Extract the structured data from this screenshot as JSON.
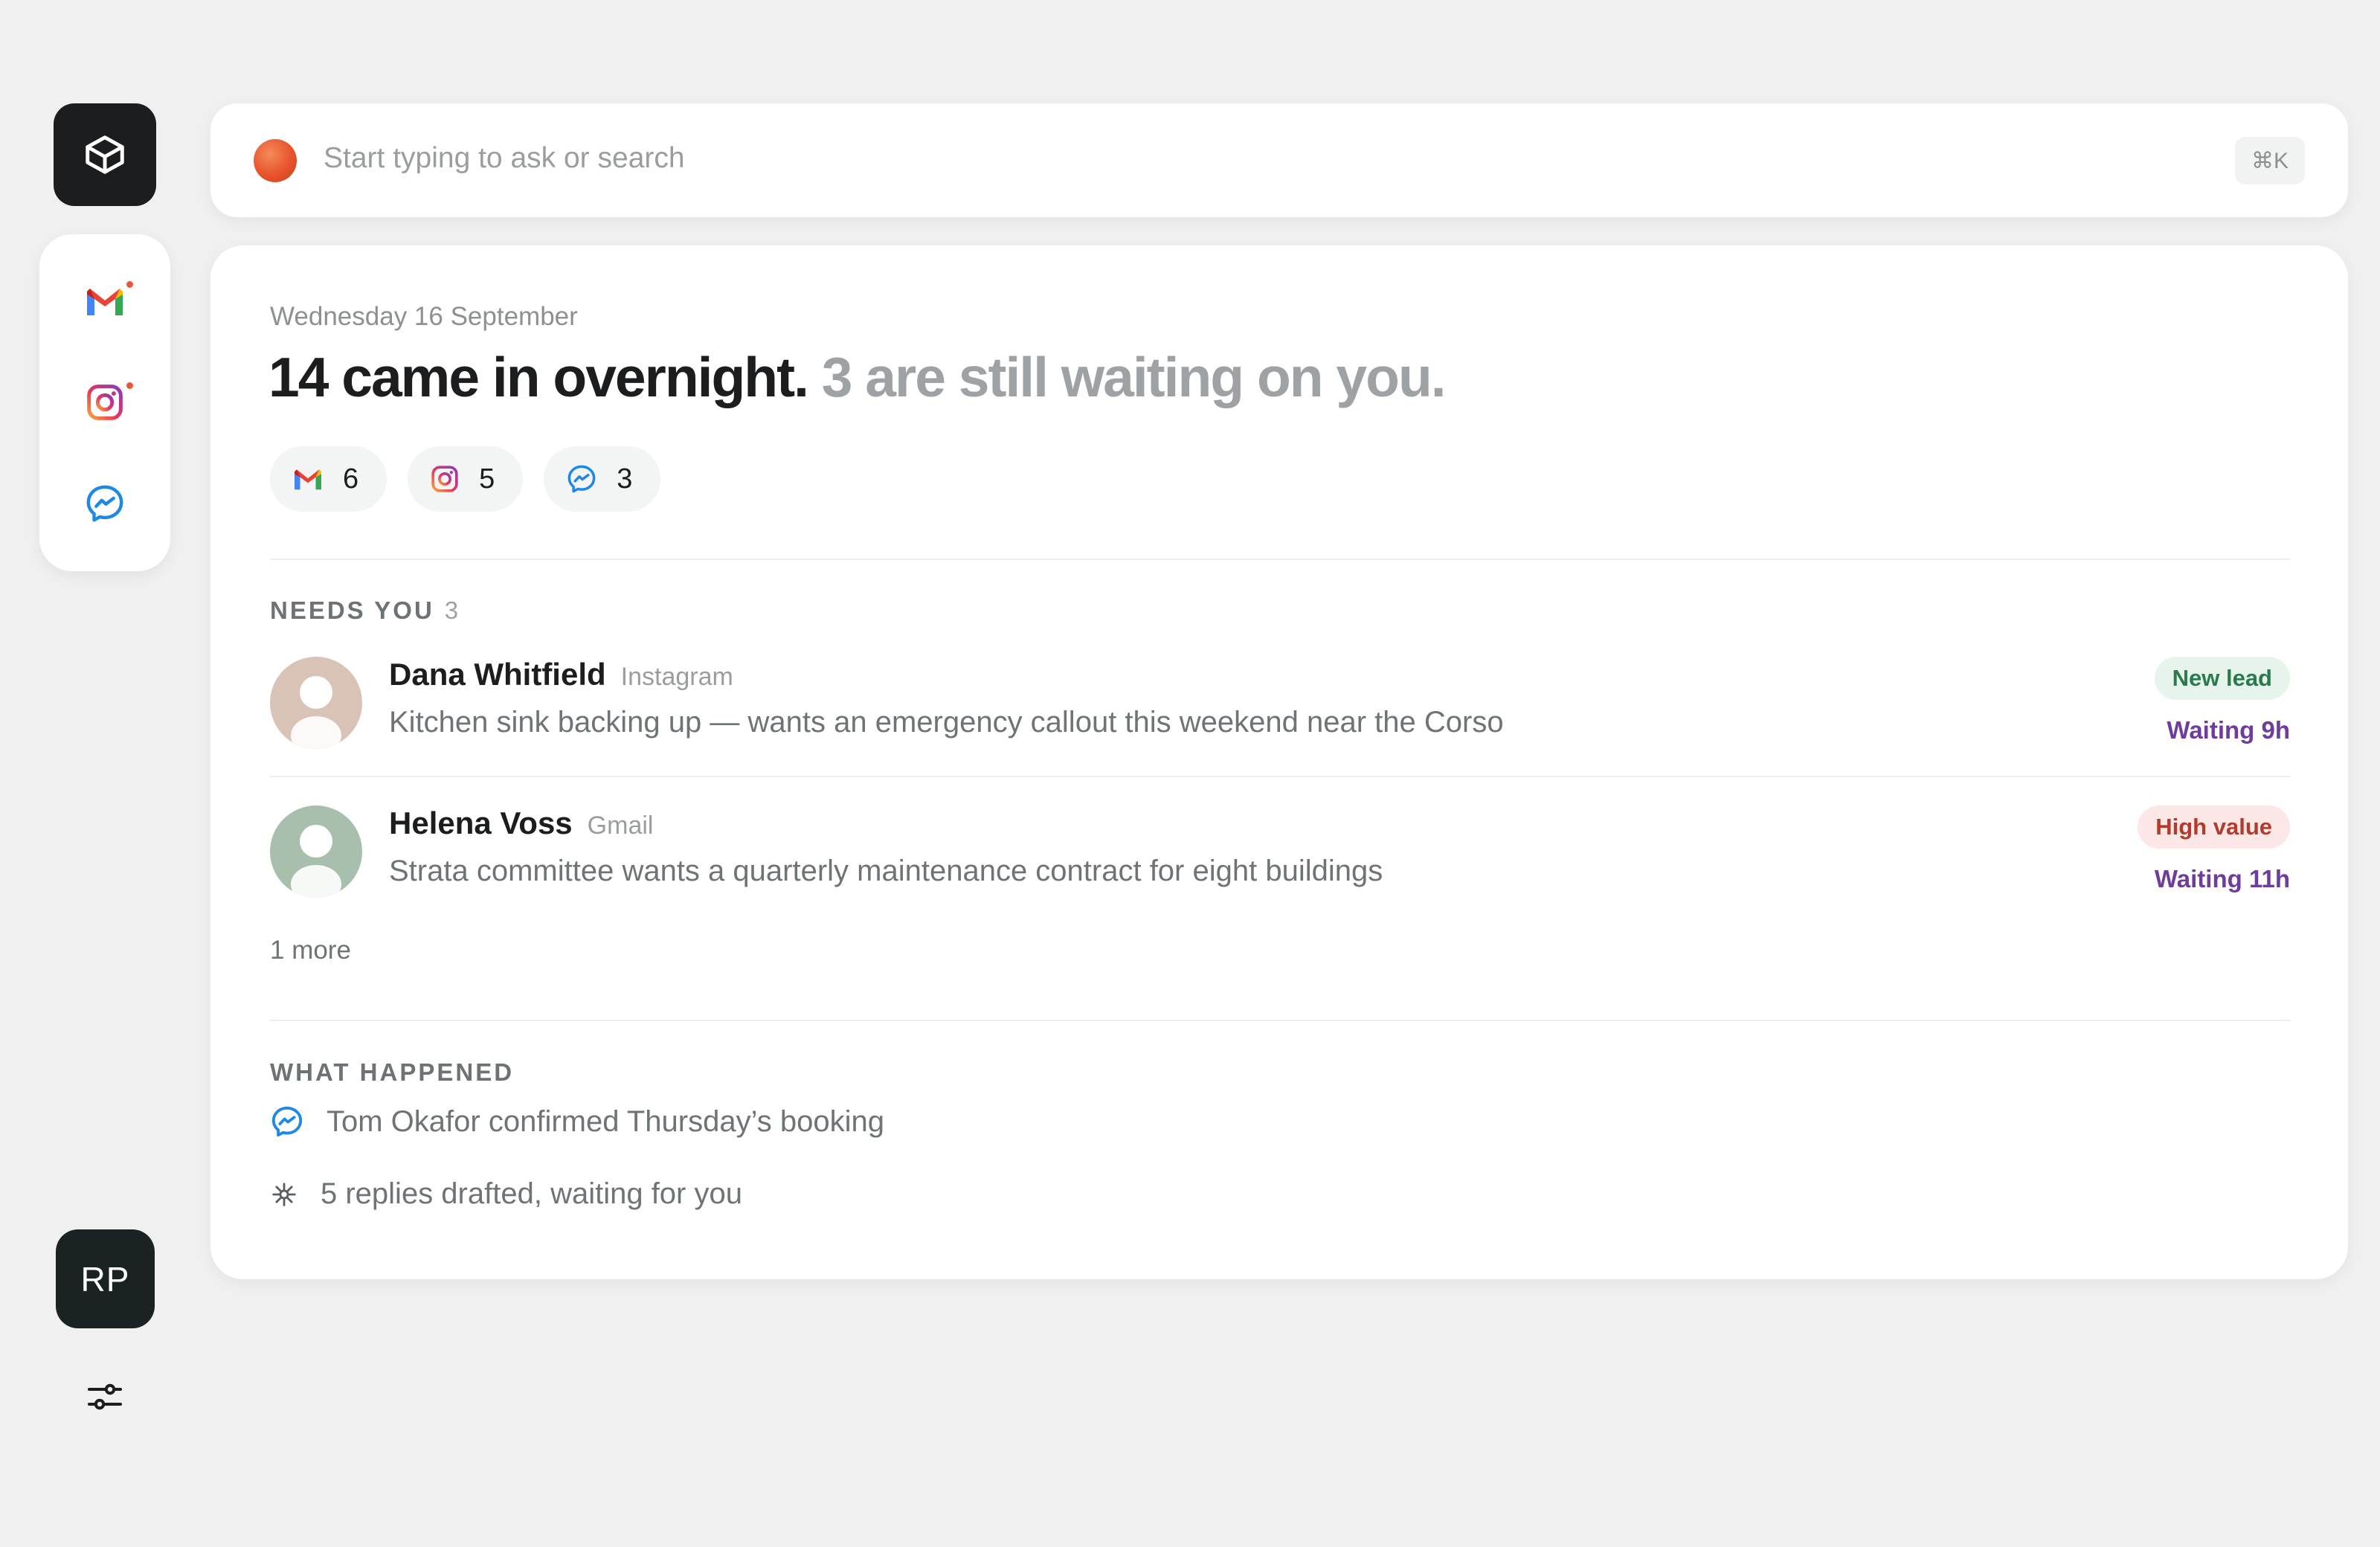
{
  "sidebar": {
    "logo_icon": "cube-icon",
    "apps": [
      {
        "name": "Gmail",
        "icon": "gmail-icon",
        "has_unread": true
      },
      {
        "name": "Instagram",
        "icon": "instagram-icon",
        "has_unread": true
      },
      {
        "name": "Messenger",
        "icon": "messenger-icon",
        "has_unread": false
      }
    ],
    "user_initials": "RP",
    "settings_icon": "sliders-icon"
  },
  "search": {
    "placeholder": "Start typing to ask or search",
    "shortcut": "⌘K"
  },
  "summary": {
    "date": "Wednesday 16 September",
    "headline_strong": "14 came in overnight.",
    "headline_muted": " 3 are still waiting on you.",
    "channels": [
      {
        "icon": "gmail-icon",
        "count": "6"
      },
      {
        "icon": "instagram-icon",
        "count": "5"
      },
      {
        "icon": "messenger-icon",
        "count": "3"
      }
    ]
  },
  "needs_you": {
    "label": "NEEDS YOU",
    "count": "3",
    "items": [
      {
        "name": "Dana Whitfield",
        "source": "Instagram",
        "preview": "Kitchen sink backing up — wants an emergency callout this weekend near the Corso",
        "tag": "New lead",
        "tag_color": "#2a7a4d",
        "waiting": "Waiting 9h",
        "avatar_color": "#d9c3b6"
      },
      {
        "name": "Helena Voss",
        "source": "Gmail",
        "preview": "Strata committee wants a quarterly maintenance contract for eight buildings",
        "tag": "High value",
        "tag_color": "#b33a2e",
        "waiting": "Waiting 11h",
        "avatar_color": "#a9bfae"
      }
    ],
    "more": "1 more"
  },
  "what_happened": {
    "label": "WHAT HAPPENED",
    "events": [
      {
        "icon": "messenger-icon",
        "text": "Tom Okafor confirmed Thursday’s booking"
      },
      {
        "icon": "sparkle-icon",
        "text": "5 replies drafted, waiting for you"
      }
    ]
  }
}
